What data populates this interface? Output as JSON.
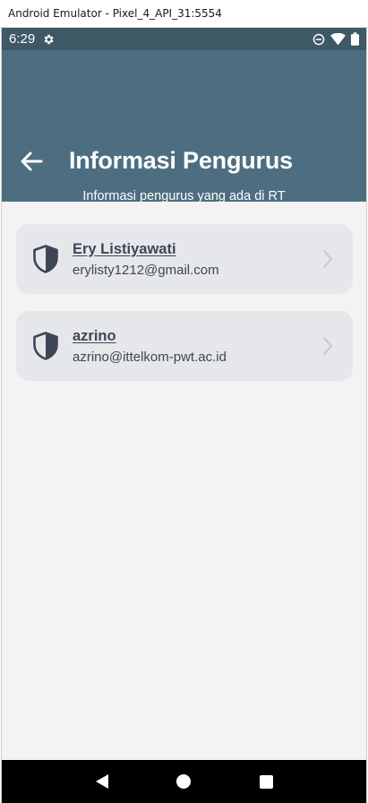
{
  "window": {
    "title": "Android Emulator - Pixel_4_API_31:5554"
  },
  "statusbar": {
    "time": "6:29",
    "icons": [
      "gear-icon",
      "do-not-disturb-icon",
      "wifi-icon",
      "battery-icon"
    ]
  },
  "appbar": {
    "title": "Informasi Pengurus",
    "subtitle": "Informasi pengurus yang ada di RT",
    "back_icon": "arrow-left-icon"
  },
  "colors": {
    "appbar": "#4d6e80",
    "statusbar": "#3f5866",
    "card": "#e6e7eb",
    "text": "#3e4656",
    "background": "#f3f3f3"
  },
  "pengurus": [
    {
      "name": "Ery Listiyawati",
      "email": "erylisty1212@gmail.com",
      "icon": "shield-icon"
    },
    {
      "name": "azrino",
      "email": "azrino@ittelkom-pwt.ac.id",
      "icon": "shield-icon"
    }
  ],
  "navbar": {
    "buttons": [
      "back-triangle-icon",
      "home-circle-icon",
      "recents-square-icon"
    ]
  }
}
